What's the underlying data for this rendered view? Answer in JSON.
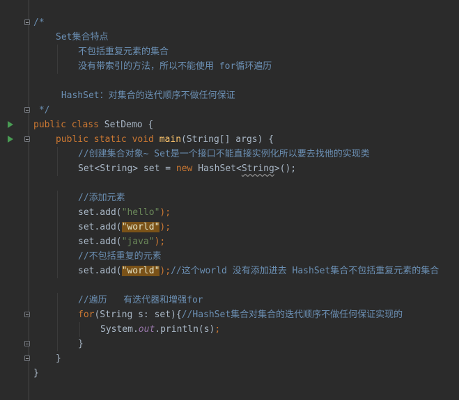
{
  "editor": {
    "lines": [
      {
        "indent": 0,
        "run": false,
        "fold": true,
        "parts": [
          {
            "t": "/*",
            "c": "doccm"
          }
        ]
      },
      {
        "indent": 1,
        "run": false,
        "fold": false,
        "parts": [
          {
            "t": "Set集合特点",
            "c": "doccm"
          }
        ]
      },
      {
        "indent": 2,
        "run": false,
        "fold": false,
        "parts": [
          {
            "t": "不包括重复元素的集合",
            "c": "doccm"
          }
        ]
      },
      {
        "indent": 2,
        "run": false,
        "fold": false,
        "parts": [
          {
            "t": "没有带索引的方法，所以不能使用 for循环遍历",
            "c": "doccm"
          }
        ]
      },
      {
        "indent": 0,
        "run": false,
        "fold": false,
        "parts": [
          {
            "t": "",
            "c": "plain"
          }
        ]
      },
      {
        "indent": 1,
        "run": false,
        "fold": false,
        "parts": [
          {
            "t": " HashSet：对集合的迭代顺序不做任何保证",
            "c": "doccm"
          }
        ]
      },
      {
        "indent": 0,
        "run": false,
        "fold": true,
        "parts": [
          {
            "t": " */",
            "c": "doccm"
          }
        ]
      },
      {
        "indent": 0,
        "run": true,
        "fold": false,
        "parts": [
          {
            "t": "public class ",
            "c": "kw"
          },
          {
            "t": "SetDemo {",
            "c": "plain"
          }
        ]
      },
      {
        "indent": 1,
        "run": true,
        "fold": true,
        "parts": [
          {
            "t": "public static void ",
            "c": "kw"
          },
          {
            "t": "main",
            "c": "fn"
          },
          {
            "t": "(String[] args) {",
            "c": "plain"
          }
        ]
      },
      {
        "indent": 2,
        "run": false,
        "fold": false,
        "parts": [
          {
            "t": "//创建集合对象~ Set是一个接口不能直接实例化所以要去找他的实现类",
            "c": "doccm"
          }
        ]
      },
      {
        "indent": 2,
        "run": false,
        "fold": false,
        "parts": [
          {
            "t": "Set<String> set = ",
            "c": "plain"
          },
          {
            "t": "new ",
            "c": "kw"
          },
          {
            "t": "HashSet<",
            "c": "plain"
          },
          {
            "t": "String",
            "c": "squig"
          },
          {
            "t": ">();",
            "c": "plain"
          }
        ]
      },
      {
        "indent": 0,
        "run": false,
        "fold": false,
        "parts": [
          {
            "t": "",
            "c": "plain"
          }
        ]
      },
      {
        "indent": 2,
        "run": false,
        "fold": false,
        "parts": [
          {
            "t": "//添加元素",
            "c": "doccm"
          }
        ]
      },
      {
        "indent": 2,
        "run": false,
        "fold": false,
        "parts": [
          {
            "t": "set.add(",
            "c": "plain"
          },
          {
            "t": "\"hello\"",
            "c": "str"
          },
          {
            "t": ");",
            "c": "kw"
          }
        ]
      },
      {
        "indent": 2,
        "run": false,
        "fold": false,
        "parts": [
          {
            "t": "set.add(",
            "c": "plain"
          },
          {
            "t": "\"world\"",
            "c": "hl-str"
          },
          {
            "t": ");",
            "c": "kw"
          }
        ]
      },
      {
        "indent": 2,
        "run": false,
        "fold": false,
        "parts": [
          {
            "t": "set.add(",
            "c": "plain"
          },
          {
            "t": "\"java\"",
            "c": "str"
          },
          {
            "t": ");",
            "c": "kw"
          }
        ]
      },
      {
        "indent": 2,
        "run": false,
        "fold": false,
        "parts": [
          {
            "t": "//不包括重复的元素",
            "c": "doccm"
          }
        ]
      },
      {
        "indent": 2,
        "run": false,
        "fold": false,
        "parts": [
          {
            "t": "set.add(",
            "c": "plain"
          },
          {
            "t": "\"world\"",
            "c": "hl-str"
          },
          {
            "t": ");",
            "c": "kw"
          },
          {
            "t": "//这个world 没有添加进去 HashSet集合不包括重复元素的集合",
            "c": "doccm"
          }
        ]
      },
      {
        "indent": 0,
        "run": false,
        "fold": false,
        "parts": [
          {
            "t": "",
            "c": "plain"
          }
        ]
      },
      {
        "indent": 2,
        "run": false,
        "fold": false,
        "parts": [
          {
            "t": "//遍历   有迭代器和增强for",
            "c": "doccm"
          }
        ]
      },
      {
        "indent": 2,
        "run": false,
        "fold": true,
        "parts": [
          {
            "t": "for",
            "c": "kw"
          },
          {
            "t": "(String s: set){",
            "c": "plain"
          },
          {
            "t": "//HashSet集合对集合的迭代顺序不做任何保证实现的",
            "c": "doccm"
          }
        ]
      },
      {
        "indent": 3,
        "run": false,
        "fold": false,
        "parts": [
          {
            "t": "System.",
            "c": "plain"
          },
          {
            "t": "out",
            "c": "st-f"
          },
          {
            "t": ".println(s)",
            "c": "plain"
          },
          {
            "t": ";",
            "c": "kw"
          }
        ]
      },
      {
        "indent": 2,
        "run": false,
        "fold": true,
        "parts": [
          {
            "t": "}",
            "c": "plain"
          }
        ]
      },
      {
        "indent": 1,
        "run": false,
        "fold": true,
        "parts": [
          {
            "t": "}",
            "c": "plain"
          }
        ]
      },
      {
        "indent": 0,
        "run": false,
        "fold": false,
        "parts": [
          {
            "t": "}",
            "c": "plain"
          }
        ]
      }
    ]
  }
}
